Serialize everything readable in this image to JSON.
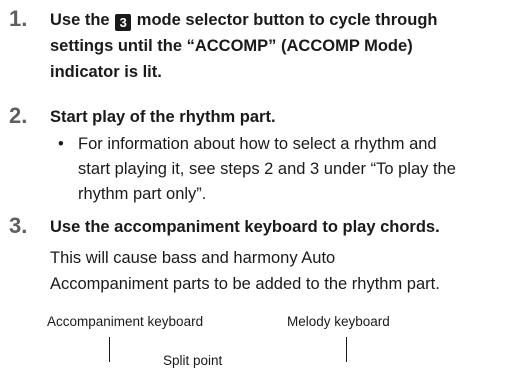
{
  "steps": [
    {
      "number": "1.",
      "text_before": "Use the",
      "badge": "3",
      "text_after": "mode selector button to cycle through",
      "line2": "settings until the “ACCOMP” (ACCOMP Mode)",
      "line3": "indicator is lit."
    },
    {
      "number": "2.",
      "text": "Start play of the rhythm part.",
      "bullet": "•",
      "bullet_lines": [
        "For information about how to select a rhythm and",
        "start playing it, see steps 2 and 3 under “To play the",
        "rhythm part only”."
      ]
    },
    {
      "number": "3.",
      "text": "Use the accompaniment keyboard to play chords.",
      "body_lines": [
        "This will cause bass and harmony Auto",
        "Accompaniment parts to be added to the rhythm part."
      ]
    }
  ],
  "diagram": {
    "accompaniment_label": "Accompaniment keyboard",
    "melody_label": "Melody keyboard",
    "split_point_label": "Split point"
  }
}
